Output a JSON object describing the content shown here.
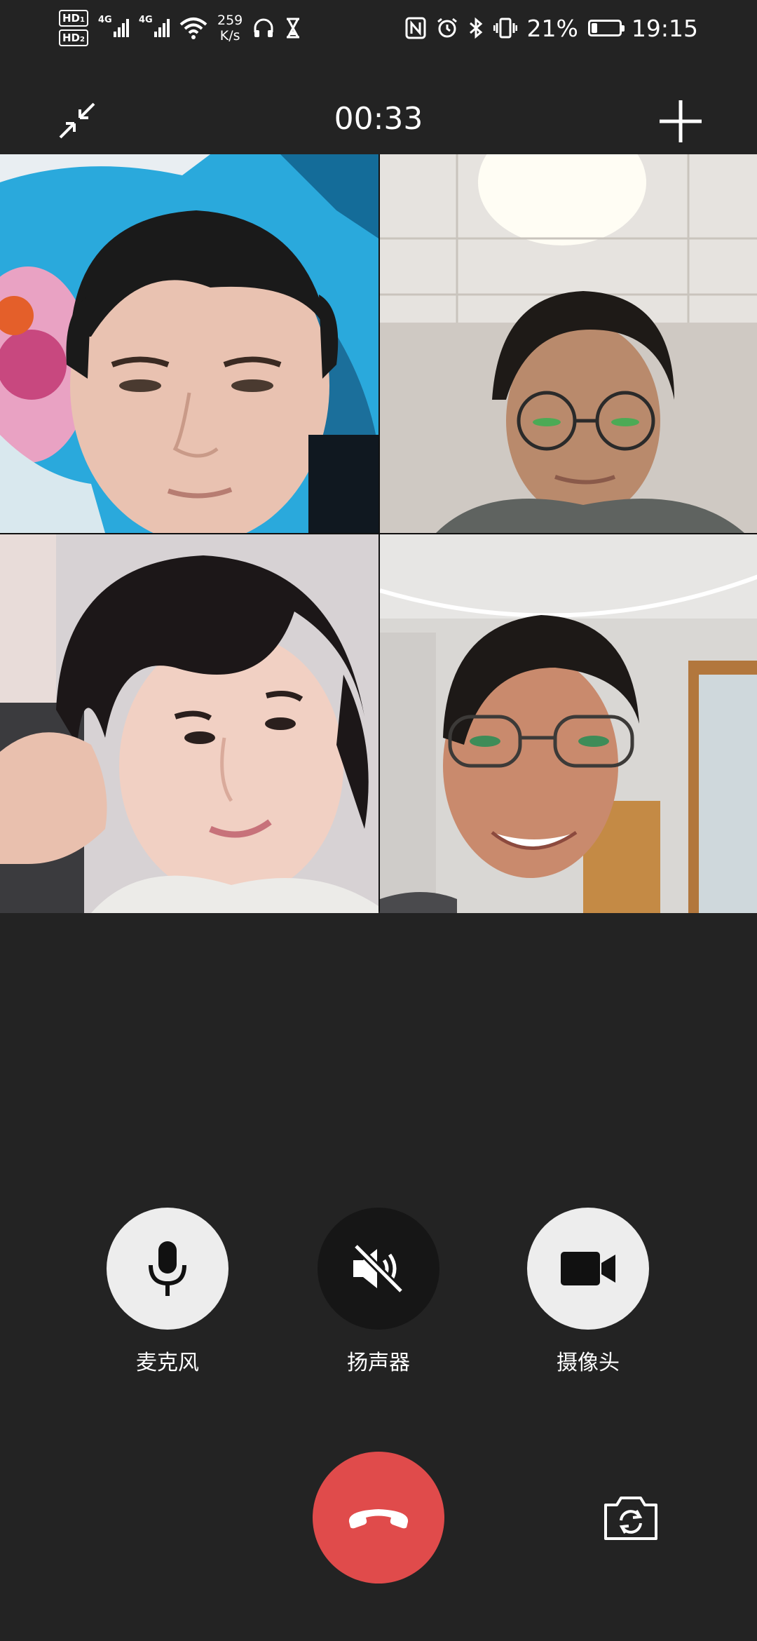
{
  "status_bar": {
    "hd1": "HD",
    "hd2": "HD",
    "network1": "4G",
    "network2": "4G",
    "speed_value": "259",
    "speed_unit": "K/s",
    "battery_percent": "21%",
    "battery_level": 0.21,
    "time": "19:15"
  },
  "call": {
    "timer": "00:33"
  },
  "controls": {
    "microphone_label": "麦克风",
    "speaker_label": "扬声器",
    "camera_label": "摄像头"
  },
  "colors": {
    "background": "#232323",
    "hangup": "#e04b4b",
    "control_light": "#ededed",
    "control_dark": "#161616"
  },
  "icons": [
    "minimize-icon",
    "add-participant-icon",
    "microphone-icon",
    "speaker-muted-icon",
    "video-camera-icon",
    "hang-up-icon",
    "switch-camera-icon"
  ]
}
